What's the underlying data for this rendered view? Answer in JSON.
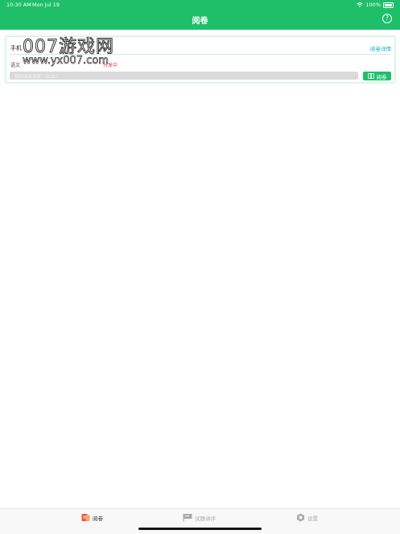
{
  "status_bar": {
    "time": "10:30 AM",
    "date": "Mon Jul 19",
    "battery": "100%"
  },
  "header": {
    "title": "阅卷",
    "help_icon": "help-icon",
    "color": "#1fbf6a"
  },
  "card": {
    "paper_name": "手机",
    "detail_link": "阅卷详情",
    "subject": "语文",
    "status": "分发中",
    "progress_label": "我的阅卷进度：",
    "progress_value": "0/267",
    "progress_fraction": 0,
    "review_button": "阅卷",
    "review_icon": "scan-icon"
  },
  "watermark": {
    "line1": "007游戏网",
    "line2": "www.yx007.com"
  },
  "tabs": [
    {
      "label": "阅卷",
      "icon": "paper-icon",
      "active": true
    },
    {
      "label": "试题讲评",
      "icon": "flag-icon",
      "active": false
    },
    {
      "label": "设置",
      "icon": "gear-icon",
      "active": false
    }
  ],
  "colors": {
    "accent": "#1fbf6a",
    "link": "#19b2c9",
    "status": "#e03a3a"
  }
}
